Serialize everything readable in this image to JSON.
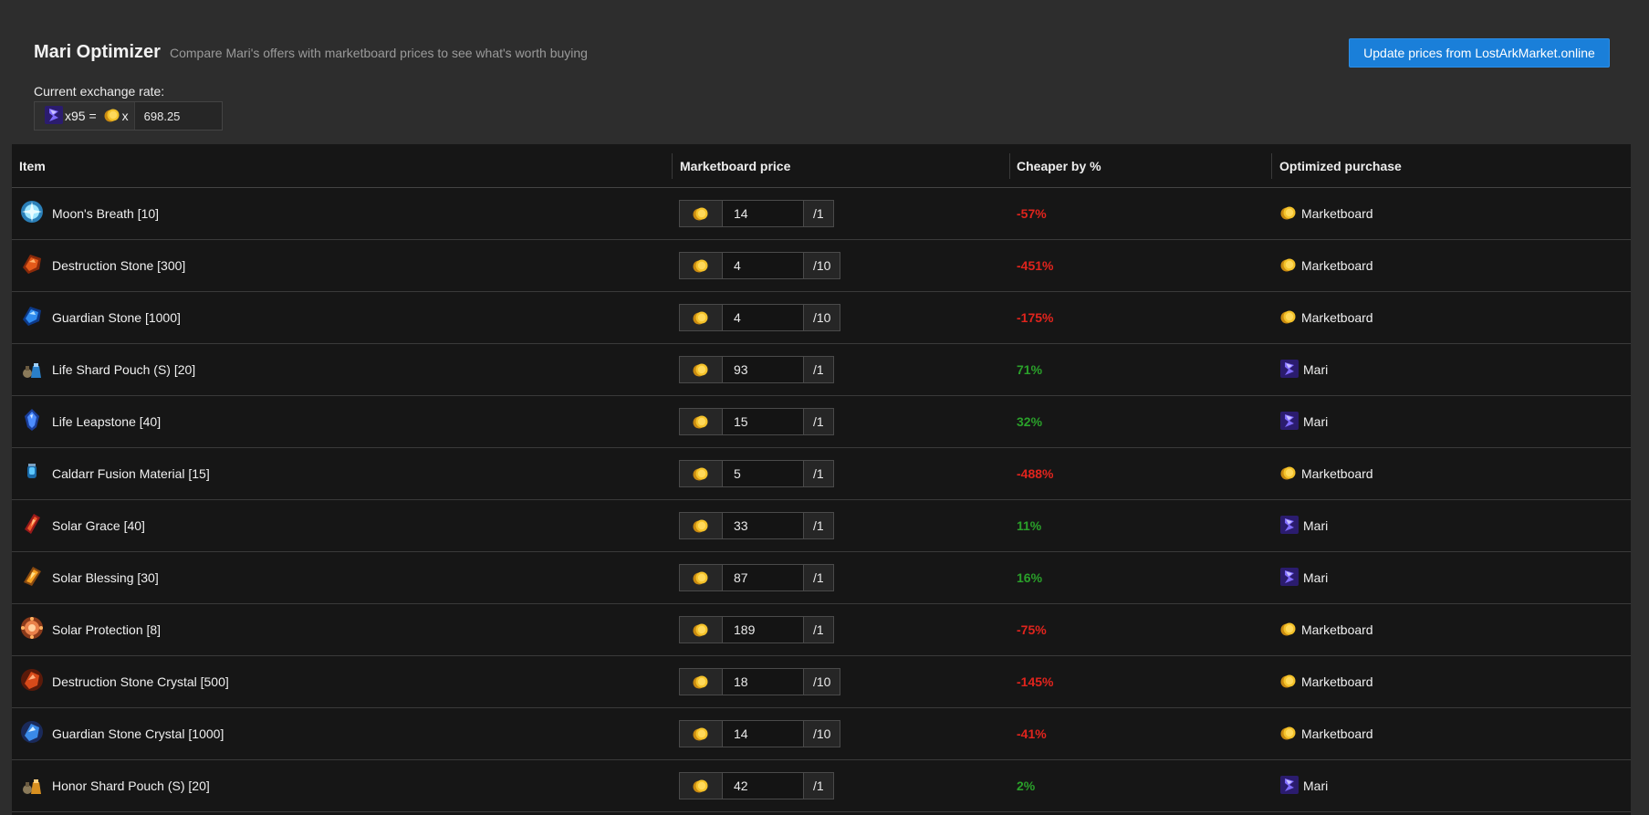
{
  "header": {
    "title": "Mari Optimizer",
    "subtitle": "Compare Mari's offers with marketboard prices to see what's worth buying",
    "update_button": "Update prices from LostArkMarket.online"
  },
  "exchange": {
    "label": "Current exchange rate:",
    "crystal_qty": "x95 =",
    "gold_suffix": "x",
    "value": "698.25"
  },
  "table": {
    "headers": [
      "Item",
      "Marketboard price",
      "Cheaper by %",
      "Optimized purchase"
    ],
    "rows": [
      {
        "name": "Moon's Breath [10]",
        "icon": "moons-breath-icon",
        "price": "14",
        "unit": "/1",
        "pct": "-57%",
        "sign": "neg",
        "purchase": "Marketboard"
      },
      {
        "name": "Destruction Stone [300]",
        "icon": "destruction-stone-icon",
        "price": "4",
        "unit": "/10",
        "pct": "-451%",
        "sign": "neg",
        "purchase": "Marketboard"
      },
      {
        "name": "Guardian Stone [1000]",
        "icon": "guardian-stone-icon",
        "price": "4",
        "unit": "/10",
        "pct": "-175%",
        "sign": "neg",
        "purchase": "Marketboard"
      },
      {
        "name": "Life Shard Pouch (S) [20]",
        "icon": "life-shard-pouch-icon",
        "price": "93",
        "unit": "/1",
        "pct": "71%",
        "sign": "pos",
        "purchase": "Mari"
      },
      {
        "name": "Life Leapstone [40]",
        "icon": "life-leapstone-icon",
        "price": "15",
        "unit": "/1",
        "pct": "32%",
        "sign": "pos",
        "purchase": "Mari"
      },
      {
        "name": "Caldarr Fusion Material [15]",
        "icon": "caldarr-fusion-material-icon",
        "price": "5",
        "unit": "/1",
        "pct": "-488%",
        "sign": "neg",
        "purchase": "Marketboard"
      },
      {
        "name": "Solar Grace [40]",
        "icon": "solar-grace-icon",
        "price": "33",
        "unit": "/1",
        "pct": "11%",
        "sign": "pos",
        "purchase": "Mari"
      },
      {
        "name": "Solar Blessing [30]",
        "icon": "solar-blessing-icon",
        "price": "87",
        "unit": "/1",
        "pct": "16%",
        "sign": "pos",
        "purchase": "Mari"
      },
      {
        "name": "Solar Protection [8]",
        "icon": "solar-protection-icon",
        "price": "189",
        "unit": "/1",
        "pct": "-75%",
        "sign": "neg",
        "purchase": "Marketboard"
      },
      {
        "name": "Destruction Stone Crystal [500]",
        "icon": "destruction-stone-crystal-icon",
        "price": "18",
        "unit": "/10",
        "pct": "-145%",
        "sign": "neg",
        "purchase": "Marketboard"
      },
      {
        "name": "Guardian Stone Crystal [1000]",
        "icon": "guardian-stone-crystal-icon",
        "price": "14",
        "unit": "/10",
        "pct": "-41%",
        "sign": "neg",
        "purchase": "Marketboard"
      },
      {
        "name": "Honor Shard Pouch (S) [20]",
        "icon": "honor-shard-pouch-icon",
        "price": "42",
        "unit": "/1",
        "pct": "2%",
        "sign": "pos",
        "purchase": "Mari"
      }
    ]
  },
  "colors": {
    "accent": "#1a7fd9",
    "negative": "#e0241d",
    "positive": "#2aa02a",
    "gold": "#f2b81f",
    "crystal": "#5a3ad8"
  }
}
